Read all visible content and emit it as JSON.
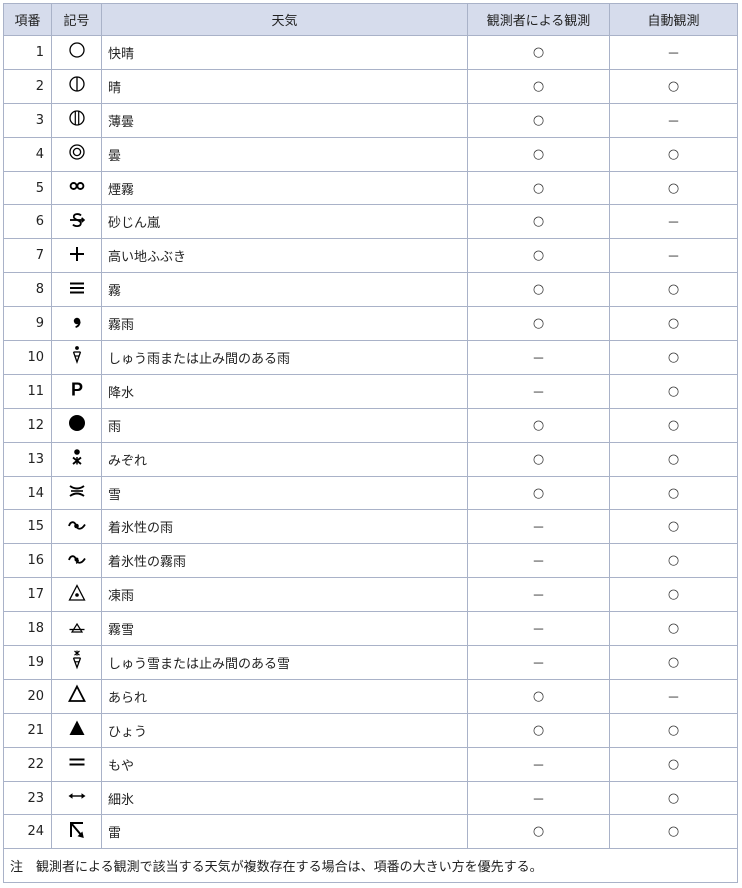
{
  "headers": [
    "項番",
    "記号",
    "天気",
    "観測者による観測",
    "自動観測"
  ],
  "rows": [
    {
      "no": "1",
      "symbol": "clear-sky-icon",
      "weather": "快晴",
      "observer": "○",
      "auto": "－"
    },
    {
      "no": "2",
      "symbol": "fine-icon",
      "weather": "晴",
      "observer": "○",
      "auto": "○"
    },
    {
      "no": "3",
      "symbol": "thin-cloud-icon",
      "weather": "薄曇",
      "observer": "○",
      "auto": "－"
    },
    {
      "no": "4",
      "symbol": "cloudy-icon",
      "weather": "曇",
      "observer": "○",
      "auto": "○"
    },
    {
      "no": "5",
      "symbol": "haze-icon",
      "weather": "煙霧",
      "observer": "○",
      "auto": "○"
    },
    {
      "no": "6",
      "symbol": "sandstorm-icon",
      "weather": "砂じん嵐",
      "observer": "○",
      "auto": "－"
    },
    {
      "no": "7",
      "symbol": "blowing-snow-icon",
      "weather": "高い地ふぶき",
      "observer": "○",
      "auto": "－"
    },
    {
      "no": "8",
      "symbol": "fog-icon",
      "weather": "霧",
      "observer": "○",
      "auto": "○"
    },
    {
      "no": "9",
      "symbol": "drizzle-icon",
      "weather": "霧雨",
      "observer": "○",
      "auto": "○"
    },
    {
      "no": "10",
      "symbol": "rain-shower-icon",
      "weather": "しゅう雨または止み間のある雨",
      "observer": "－",
      "auto": "○"
    },
    {
      "no": "11",
      "symbol": "precipitation-icon",
      "weather": "降水",
      "observer": "－",
      "auto": "○"
    },
    {
      "no": "12",
      "symbol": "rain-icon",
      "weather": "雨",
      "observer": "○",
      "auto": "○"
    },
    {
      "no": "13",
      "symbol": "sleet-icon",
      "weather": "みぞれ",
      "observer": "○",
      "auto": "○"
    },
    {
      "no": "14",
      "symbol": "snow-icon",
      "weather": "雪",
      "observer": "○",
      "auto": "○"
    },
    {
      "no": "15",
      "symbol": "freezing-rain-icon",
      "weather": "着氷性の雨",
      "observer": "－",
      "auto": "○"
    },
    {
      "no": "16",
      "symbol": "freezing-drizzle-icon",
      "weather": "着氷性の霧雨",
      "observer": "－",
      "auto": "○"
    },
    {
      "no": "17",
      "symbol": "ice-pellets-icon",
      "weather": "凍雨",
      "observer": "－",
      "auto": "○"
    },
    {
      "no": "18",
      "symbol": "snow-grains-icon",
      "weather": "霧雪",
      "observer": "－",
      "auto": "○"
    },
    {
      "no": "19",
      "symbol": "snow-shower-icon",
      "weather": "しゅう雪または止み間のある雪",
      "observer": "－",
      "auto": "○"
    },
    {
      "no": "20",
      "symbol": "snow-pellets-icon",
      "weather": "あられ",
      "observer": "○",
      "auto": "－"
    },
    {
      "no": "21",
      "symbol": "hail-icon",
      "weather": "ひょう",
      "observer": "○",
      "auto": "○"
    },
    {
      "no": "22",
      "symbol": "mist-icon",
      "weather": "もや",
      "observer": "－",
      "auto": "○"
    },
    {
      "no": "23",
      "symbol": "diamond-dust-icon",
      "weather": "細氷",
      "observer": "－",
      "auto": "○"
    },
    {
      "no": "24",
      "symbol": "thunder-icon",
      "weather": "雷",
      "observer": "○",
      "auto": "○"
    }
  ],
  "note": "注　観測者による観測で該当する天気が複数存在する場合は、項番の大きい方を優先する。"
}
